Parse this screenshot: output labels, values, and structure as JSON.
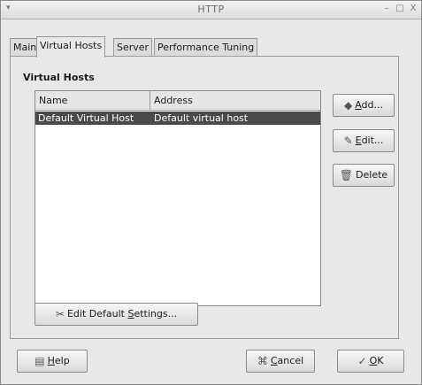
{
  "window": {
    "title": "HTTP",
    "controls": {
      "minimize": "–",
      "maximize": "□",
      "close": "X"
    }
  },
  "tabs": [
    {
      "label": "Main"
    },
    {
      "label": "Virtual Hosts"
    },
    {
      "label": "Server"
    },
    {
      "label": "Performance Tuning"
    }
  ],
  "active_tab": "Virtual Hosts",
  "virtual_hosts": {
    "section_title": "Virtual Hosts",
    "columns": [
      "Name",
      "Address"
    ],
    "rows": [
      {
        "name": "Default Virtual Host",
        "address": "Default virtual host"
      }
    ],
    "buttons": {
      "add": {
        "prefix": "",
        "mnemonic": "A",
        "suffix": "dd...",
        "icon": "add-icon"
      },
      "edit": {
        "prefix": "",
        "mnemonic": "E",
        "suffix": "dit...",
        "icon": "edit-icon"
      },
      "delete": {
        "label": "Delete",
        "icon": "delete-icon"
      },
      "edit_defaults": {
        "prefix": "Edit Default ",
        "mnemonic": "S",
        "suffix": "ettings...",
        "icon": "settings-icon"
      }
    }
  },
  "footer": {
    "help": {
      "mnemonic": "H",
      "suffix": "elp",
      "icon": "help-icon"
    },
    "cancel": {
      "mnemonic": "C",
      "suffix": "ancel",
      "icon": "cancel-icon"
    },
    "ok": {
      "mnemonic": "O",
      "suffix": "K",
      "icon": "ok-icon"
    }
  }
}
